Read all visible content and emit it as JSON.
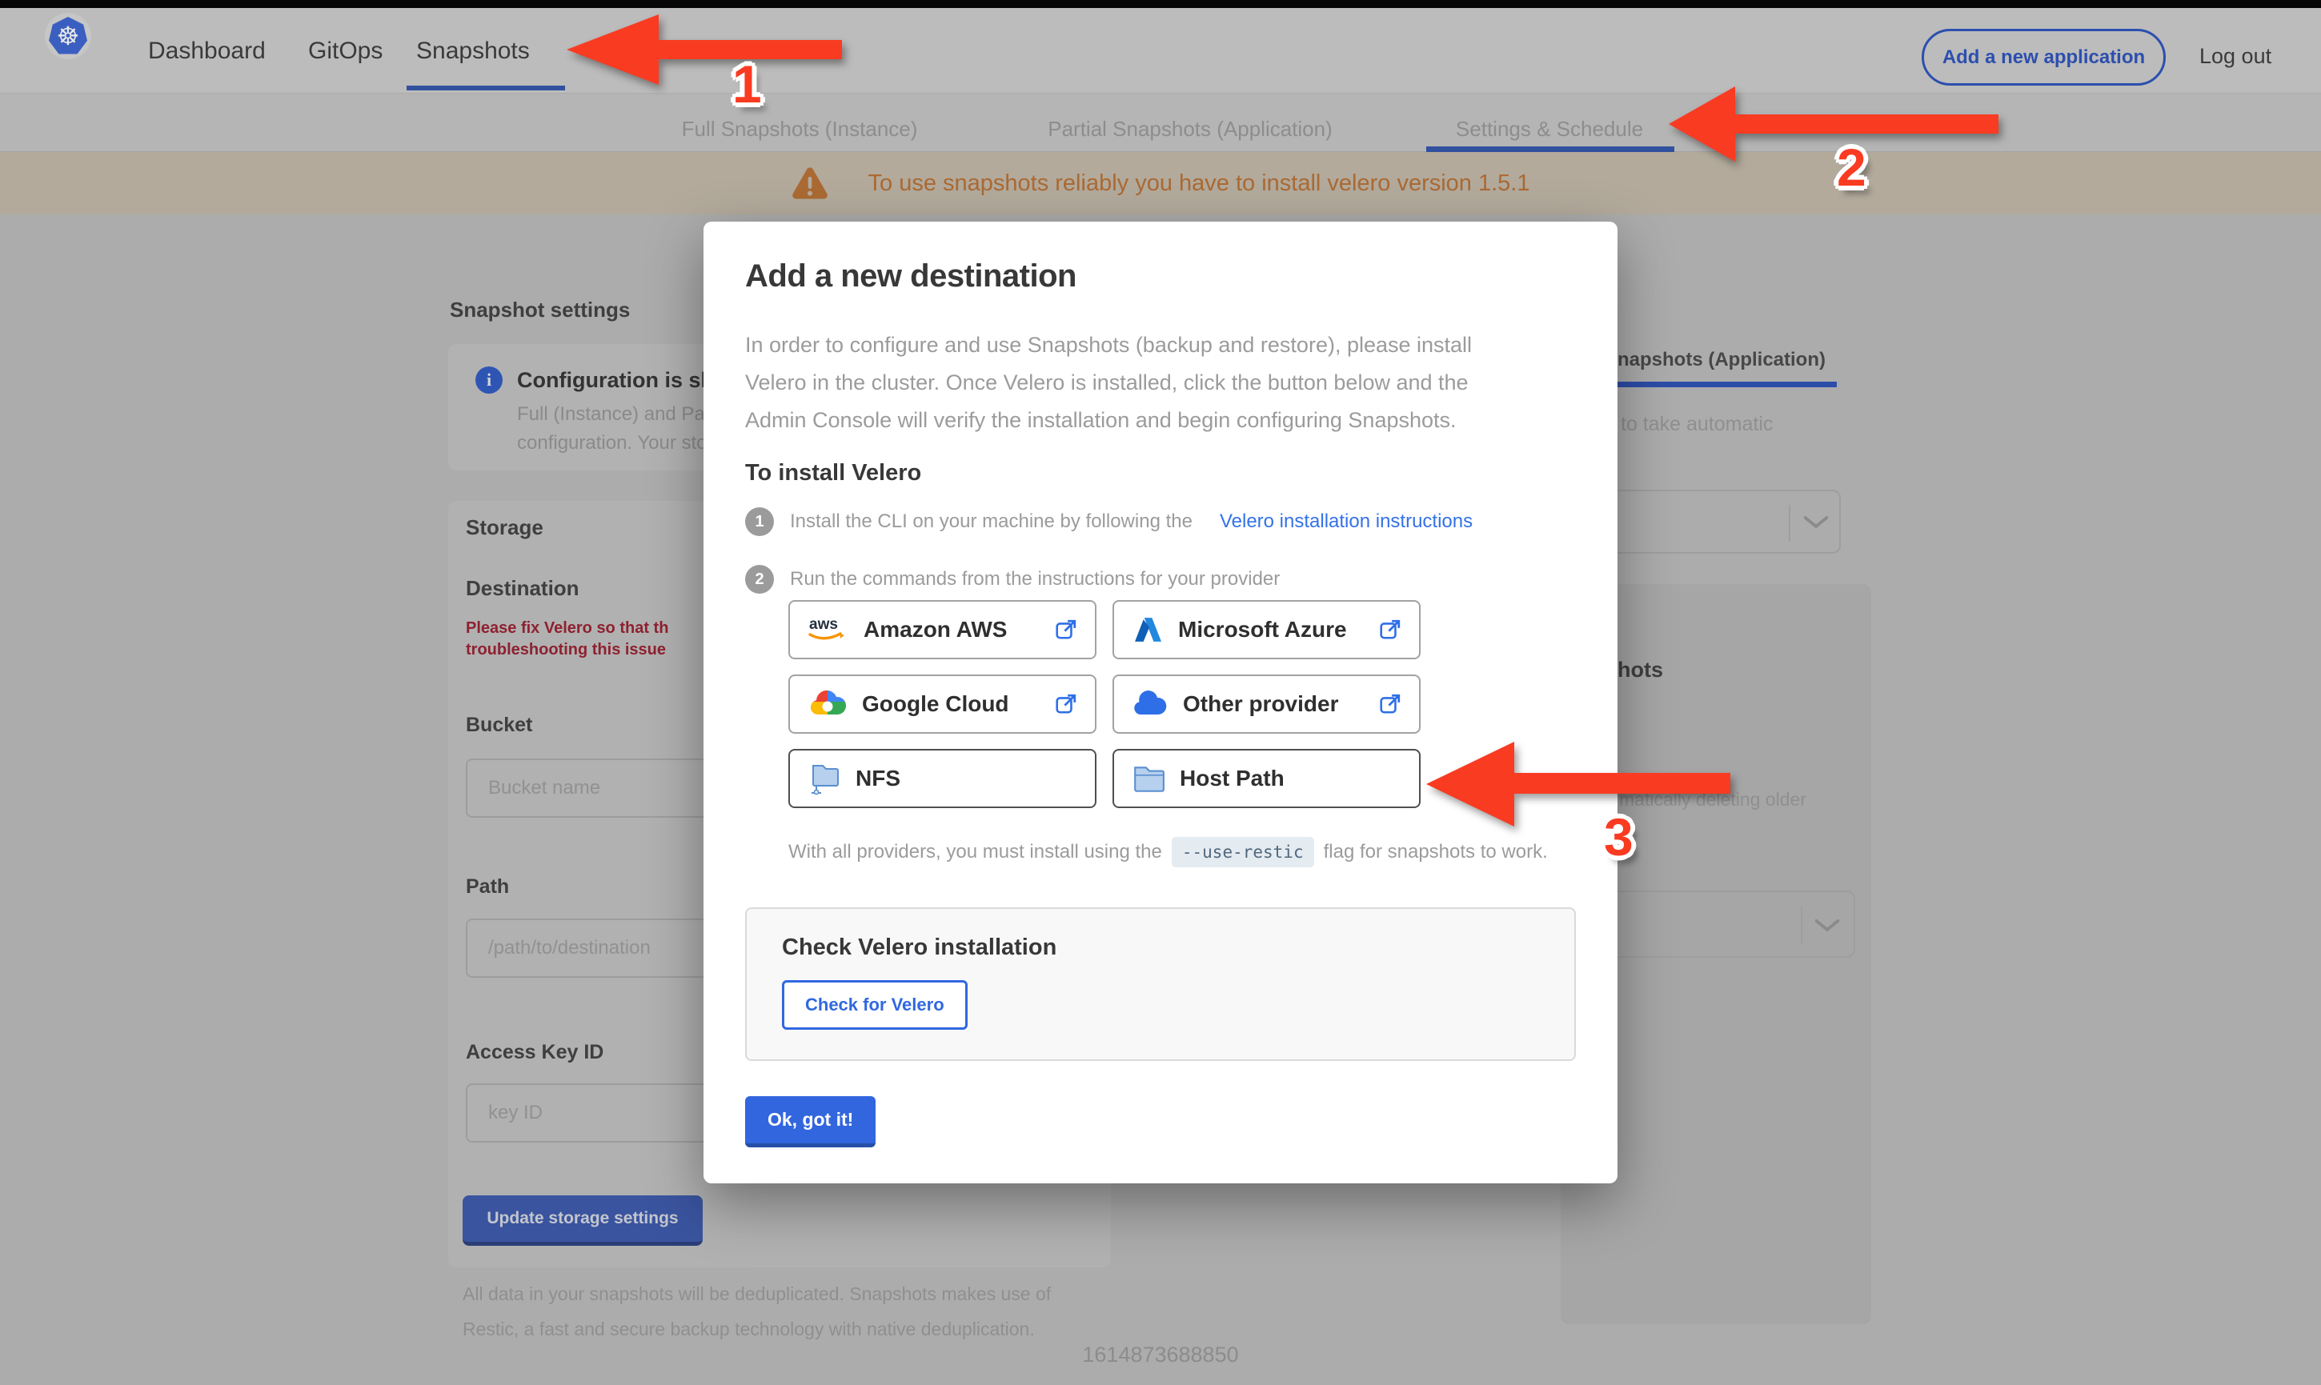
{
  "navbar": {
    "items": [
      {
        "label": "Dashboard",
        "active": false
      },
      {
        "label": "GitOps",
        "active": false
      },
      {
        "label": "Snapshots",
        "active": true
      }
    ],
    "add_application_label": "Add a new application",
    "logout_label": "Log out"
  },
  "subnav": {
    "tabs": [
      {
        "label": "Full Snapshots (Instance)",
        "active": false
      },
      {
        "label": "Partial Snapshots (Application)",
        "active": false
      },
      {
        "label": "Settings & Schedule",
        "active": true
      }
    ]
  },
  "warning": {
    "message": "To use snapshots reliably you have to install velero version 1.5.1"
  },
  "settings_page": {
    "title": "Snapshot settings",
    "info_card": {
      "title_visible": "Configuration is sh",
      "line1_visible": "Full (Instance) and Parti",
      "line2_visible": "configuration. Your stor"
    },
    "storage_section": {
      "title": "Storage",
      "destination_label": "Destination",
      "error_line1": "Please fix Velero so that th",
      "error_line2": "troubleshooting this issue",
      "bucket_label": "Bucket",
      "bucket_placeholder": "Bucket name",
      "path_label": "Path",
      "path_placeholder": "/path/to/destination",
      "access_key_label": "Access Key ID",
      "access_key_placeholder": "key ID",
      "update_button_label": "Update storage settings"
    },
    "footnote_line1": "All data in your snapshots will be deduplicated. Snapshots makes use of",
    "footnote_line2": "Restic, a fast and secure backup technology with native deduplication.",
    "right_panel": {
      "tab_visible": "napshots (Application)",
      "auto_text_visible": "to take automatic",
      "heading_visible": "hots",
      "deleting_text_visible": "matically deleting older"
    },
    "footer_timestamp": "1614873688850"
  },
  "modal": {
    "title": "Add a new destination",
    "intro_line1": "In order to configure and use Snapshots (backup and restore), please install",
    "intro_line2": "Velero in the cluster. Once Velero is installed, click the button below and the",
    "intro_line3": "Admin Console will verify the installation and begin configuring Snapshots.",
    "install_heading": "To install Velero",
    "steps": [
      {
        "number": "1",
        "text": "Install the CLI on your machine by following the",
        "link": "Velero installation instructions"
      },
      {
        "number": "2",
        "text": "Run the commands from the instructions for your provider",
        "link": ""
      }
    ],
    "providers": [
      {
        "label": "Amazon AWS"
      },
      {
        "label": "Microsoft Azure"
      },
      {
        "label": "Google Cloud"
      },
      {
        "label": "Other provider"
      },
      {
        "label": "NFS"
      },
      {
        "label": "Host Path"
      }
    ],
    "restic_before": "With all providers, you must install using the",
    "restic_code": "--use-restic",
    "restic_after": "flag for snapshots to work.",
    "check_box": {
      "title": "Check Velero installation",
      "button_label": "Check for Velero"
    },
    "ok_button_label": "Ok, got it!"
  },
  "annotations": {
    "labels": [
      "1",
      "2",
      "3"
    ]
  },
  "colors": {
    "accent_blue": "#326de6",
    "link_blue": "#3472e8",
    "annotation_red": "#f93b22",
    "warning_orange": "#ab6a33",
    "error_red": "#8e2130",
    "aws_orange": "#f79400",
    "azure_blue": "#2288dd",
    "gcp_palette": [
      "#ea4335",
      "#4285f4",
      "#fbbc05",
      "#34a853"
    ]
  }
}
